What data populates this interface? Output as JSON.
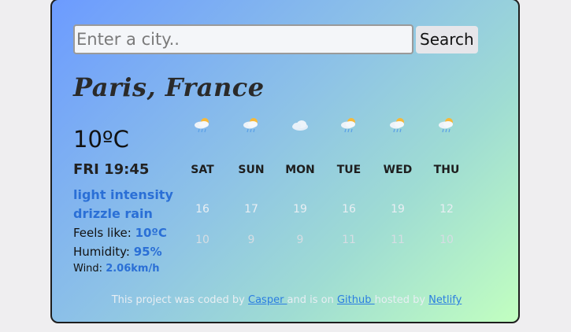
{
  "search": {
    "placeholder": "Enter a city..",
    "button_label": "Search"
  },
  "current": {
    "city": "Paris, France",
    "temperature": "10ºC",
    "datetime": "FRI 19:45",
    "description": "light intensity drizzle rain",
    "feels_like_label": "Feels like: ",
    "feels_like_value": "10ºC",
    "humidity_label": "Humidity: ",
    "humidity_value": "95%",
    "wind_label": "Wind: ",
    "wind_value": "2.06km/h"
  },
  "forecast": [
    {
      "day": "SAT",
      "high": "16",
      "low": "10",
      "icon": "sun-cloud-rain-icon"
    },
    {
      "day": "SUN",
      "high": "17",
      "low": "9",
      "icon": "sun-cloud-rain-icon"
    },
    {
      "day": "MON",
      "high": "19",
      "low": "9",
      "icon": "cloud-icon"
    },
    {
      "day": "TUE",
      "high": "16",
      "low": "11",
      "icon": "sun-cloud-rain-icon"
    },
    {
      "day": "WED",
      "high": "19",
      "low": "11",
      "icon": "sun-cloud-rain-icon"
    },
    {
      "day": "THU",
      "high": "12",
      "low": "10",
      "icon": "sun-cloud-rain-icon"
    }
  ],
  "footer": {
    "text_1": "This project was coded by ",
    "link_1": "Casper ",
    "text_2": "and is on ",
    "link_2": "Github ",
    "text_3": "hosted by ",
    "link_3": "Netlify"
  },
  "colors": {
    "accent": "#2a6fd6",
    "link": "#2a7de1",
    "gradient_start": "#6c9bff",
    "gradient_end": "#c2ffc0"
  }
}
